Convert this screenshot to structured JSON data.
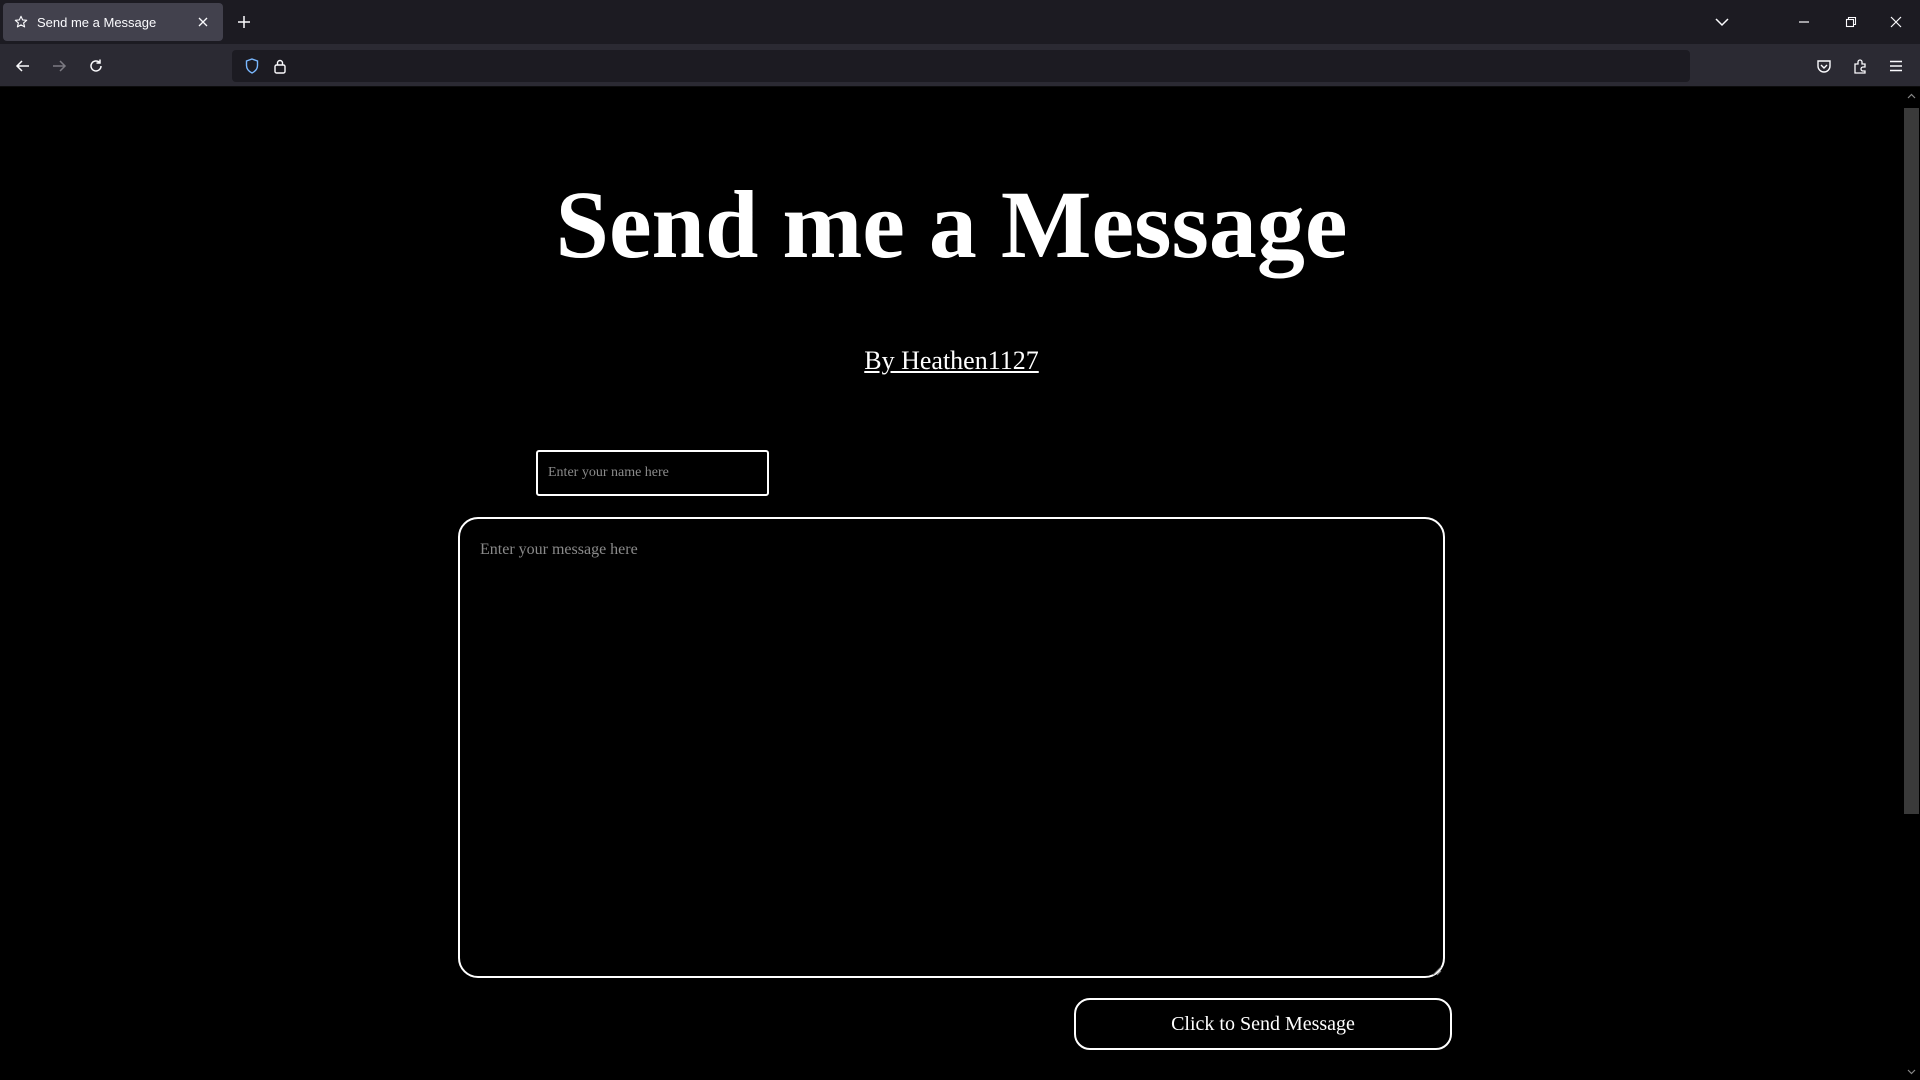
{
  "browser": {
    "tab_title": "Send me a Message",
    "tab_icon": "star-icon",
    "url": ""
  },
  "page": {
    "title": "Send me a Message",
    "byline": "By Heathen1127",
    "name_placeholder": "Enter your name here",
    "message_placeholder": "Enter your message here",
    "send_label": "Click to Send Message"
  },
  "colors": {
    "background": "#000000",
    "foreground": "#ffffff",
    "chrome_dark": "#1c1b22",
    "chrome_mid": "#2b2a33",
    "tab_active": "#42414d",
    "shield_blue": "#7ab8ff"
  }
}
